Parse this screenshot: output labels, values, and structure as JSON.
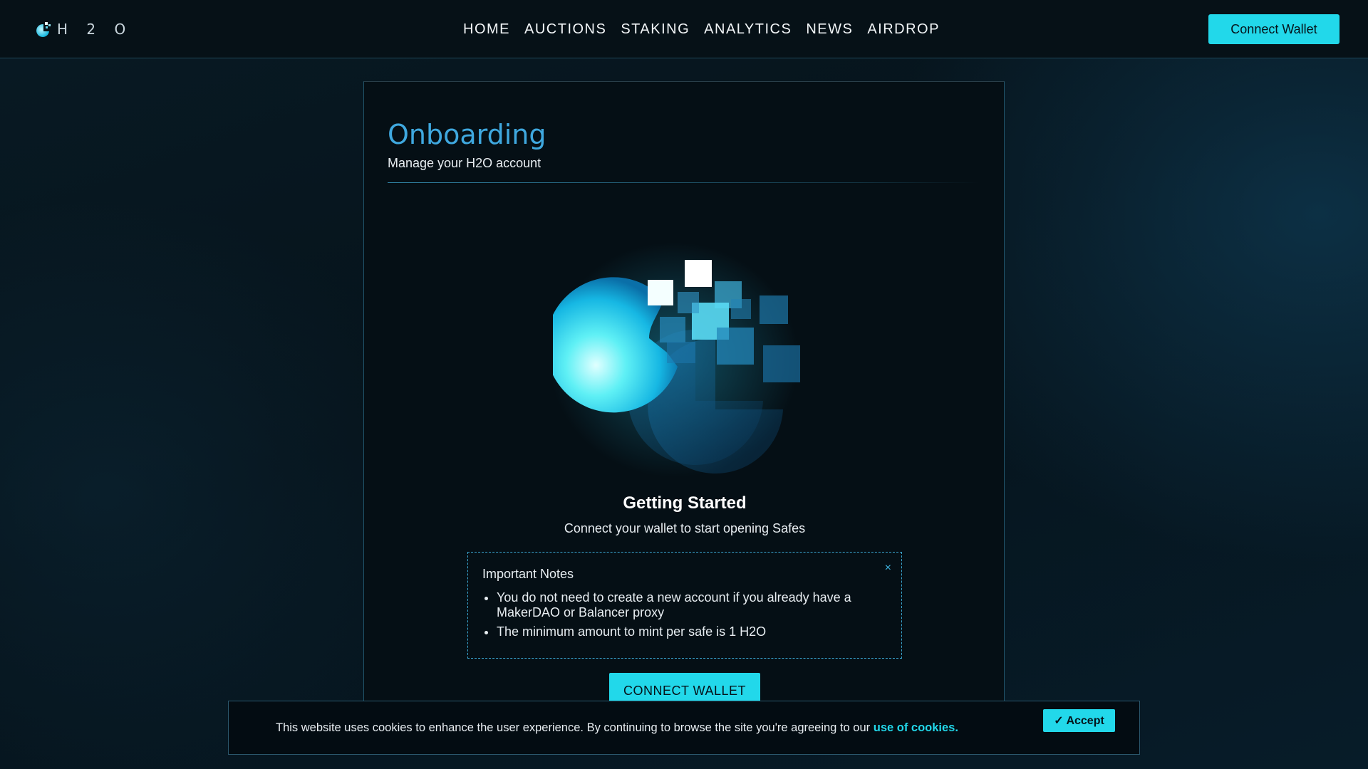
{
  "header": {
    "logo_text": "H 2 O",
    "nav": [
      "HOME",
      "AUCTIONS",
      "STAKING",
      "ANALYTICS",
      "NEWS",
      "AIRDROP"
    ],
    "connect_wallet_label": "Connect Wallet"
  },
  "onboarding": {
    "title": "Onboarding",
    "subtitle": "Manage your H2O account",
    "getting_started_title": "Getting Started",
    "getting_started_subtitle": "Connect your wallet to start opening Safes",
    "notes": {
      "title": "Important Notes",
      "close_icon": "×",
      "items": [
        "You do not need to create a new account if you already have a MakerDAO or Balancer proxy",
        "The minimum amount to mint per safe is 1 H2O"
      ]
    },
    "connect_wallet_label": "CONNECT WALLET"
  },
  "cookie_banner": {
    "text": "This website uses cookies to enhance the user experience. By continuing to browse the site you're agreeing to our ",
    "link_text": "use of cookies.",
    "accept_label": "✓ Accept"
  },
  "colors": {
    "accent": "#22d8ea",
    "title_blue": "#3fa8df",
    "background": "#06131b"
  },
  "icons": [
    "h2o-logo-icon",
    "close-icon",
    "h2o-hero-graphic"
  ]
}
